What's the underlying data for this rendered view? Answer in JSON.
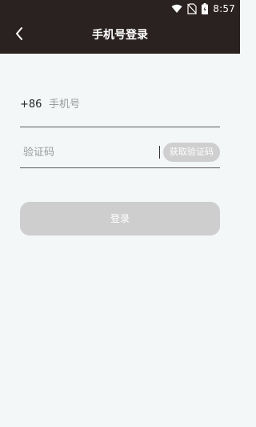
{
  "status_bar": {
    "time": "8:57",
    "icons": [
      "wifi-icon",
      "no-sim-icon",
      "battery-charging-icon"
    ]
  },
  "header": {
    "title": "手机号登录",
    "back_icon": "chevron-left-icon"
  },
  "form": {
    "country_code": "+86",
    "phone_placeholder": "手机号",
    "code_placeholder": "验证码",
    "get_code_label": "获取验证码"
  },
  "login_button": {
    "label": "登录"
  },
  "colors": {
    "header_bg": "#2a2220",
    "page_bg": "#f4f7f8",
    "disabled_button": "#cecece"
  }
}
